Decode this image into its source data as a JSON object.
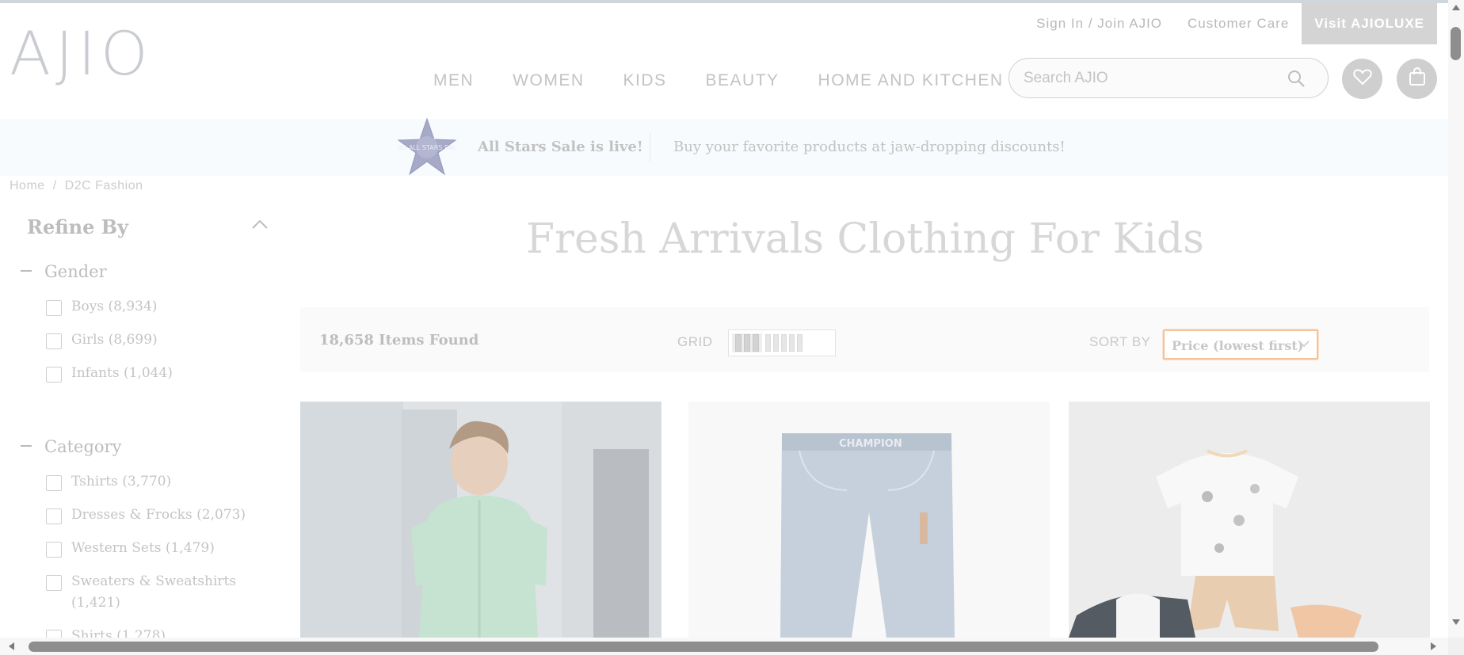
{
  "header": {
    "logo": "AJIO",
    "top_links": {
      "signin": "Sign In / Join AJIO",
      "care": "Customer Care",
      "luxe": "Visit AJIOLUXE"
    },
    "nav": [
      "MEN",
      "WOMEN",
      "KIDS",
      "BEAUTY",
      "HOME AND KITCHEN"
    ],
    "search": {
      "placeholder": "Search AJIO"
    }
  },
  "banner": {
    "badge_text": "AJIO ALL STARS SALE",
    "headline": "All Stars Sale is live!",
    "subline": "Buy your favorite products at jaw-dropping discounts!"
  },
  "breadcrumb": [
    "Home",
    "D2C Fashion"
  ],
  "sidebar": {
    "title": "Refine By",
    "groups": [
      {
        "title": "Gender",
        "options": [
          "Boys (8,934)",
          "Girls (8,699)",
          "Infants (1,044)"
        ]
      },
      {
        "title": "Category",
        "options": [
          "Tshirts (3,770)",
          "Dresses & Frocks (2,073)",
          "Western Sets (1,479)",
          "Sweaters & Sweatshirts (1,421)",
          "Shirts (1,278)"
        ]
      }
    ]
  },
  "main": {
    "title": "Fresh Arrivals Clothing For Kids",
    "items_found": "18,658 Items Found",
    "grid_label": "GRID",
    "sort_label": "SORT BY",
    "sort_value": "Price (lowest first)",
    "jeans_brand": "CHAMPION"
  },
  "colors": {
    "accent_sort_border": "#f3c49b",
    "luxe_bg": "#d4d4d4"
  }
}
